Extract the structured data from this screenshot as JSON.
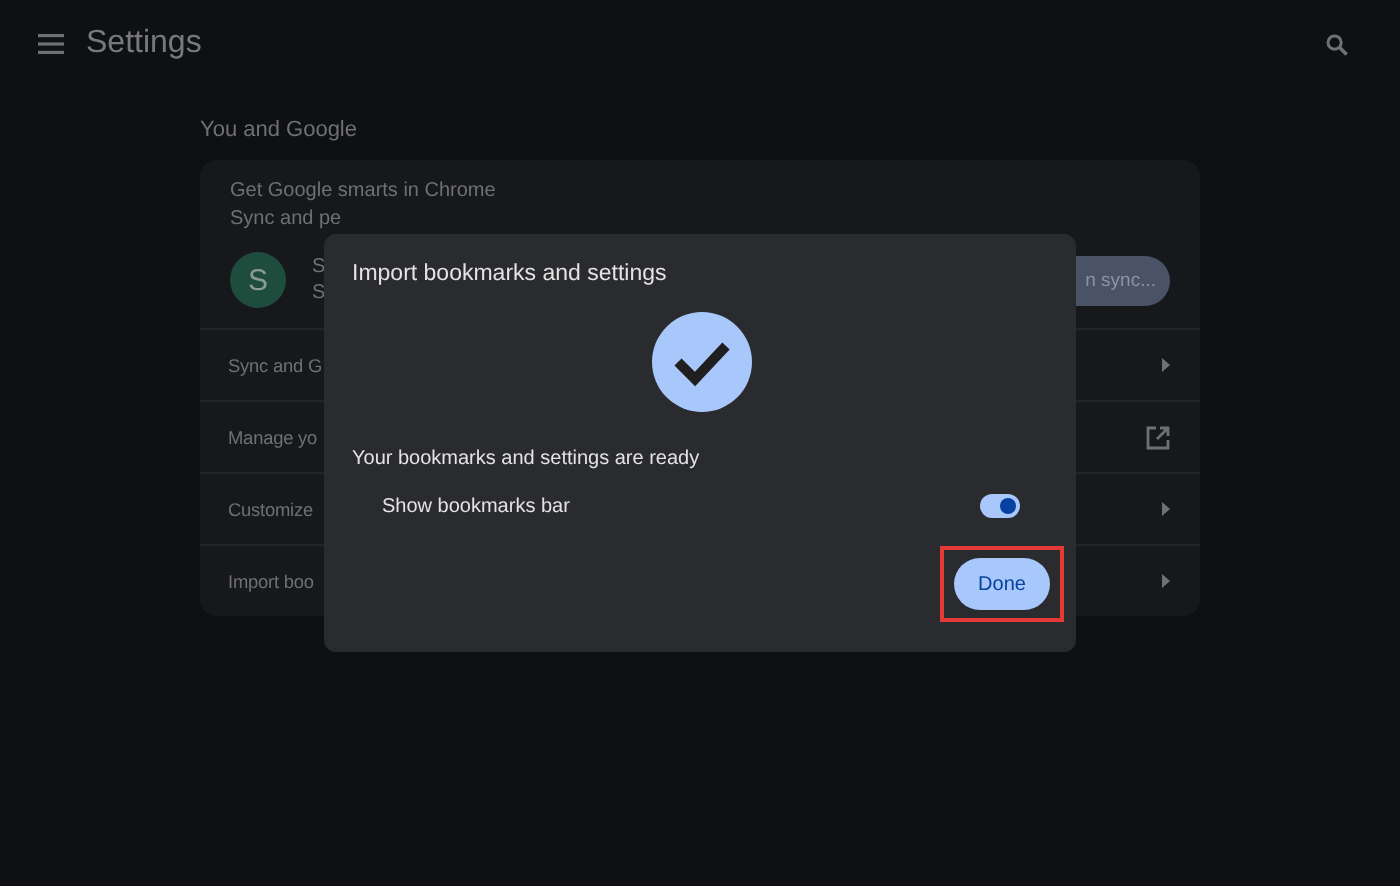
{
  "header": {
    "title": "Settings"
  },
  "section_title": "You and Google",
  "card": {
    "promo_title": "Get Google smarts in Chrome",
    "promo_text": "Sync and pe",
    "avatar_letter": "S",
    "account_lines": [
      "S",
      "S"
    ],
    "sync_button": "n sync...",
    "rows": [
      {
        "label": "Sync and G",
        "kind": "chevron"
      },
      {
        "label": "Manage yo",
        "kind": "external"
      },
      {
        "label": "Customize",
        "kind": "chevron"
      },
      {
        "label": "Import boo",
        "kind": "chevron"
      }
    ]
  },
  "dialog": {
    "title": "Import bookmarks and settings",
    "message": "Your bookmarks and settings are ready",
    "toggle": {
      "label": "Show bookmarks bar",
      "on": true
    },
    "done_button": {
      "label": "Done",
      "highlighted": true
    }
  }
}
